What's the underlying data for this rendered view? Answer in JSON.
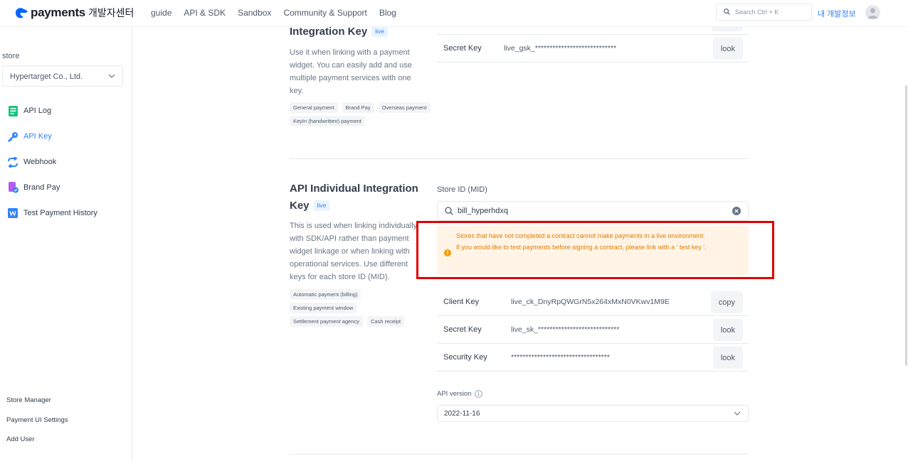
{
  "header": {
    "logo_text": "payments",
    "logo_sub": "개발자센터",
    "nav": [
      "guide",
      "API & SDK",
      "Sandbox",
      "Community & Support",
      "Blog"
    ],
    "search_placeholder": "Search Ctrl + K",
    "my_dev_info": "내 개발정보"
  },
  "sidebar": {
    "store_label": "store",
    "store_value": "Hypertarget Co., Ltd.",
    "items": [
      {
        "label": "API Log",
        "icon": "api-log-icon",
        "color": "#15c47e"
      },
      {
        "label": "API Key",
        "icon": "key-icon",
        "color": "#3182f6"
      },
      {
        "label": "Webhook",
        "icon": "webhook-icon",
        "color": "#3182f6"
      },
      {
        "label": "Brand Pay",
        "icon": "brand-pay-icon",
        "color": "#b45cf0"
      },
      {
        "label": "Test Payment History",
        "icon": "test-history-icon",
        "color": "#3182f6"
      }
    ],
    "bottom_links": [
      "Store Manager",
      "Payment UI Settings",
      "Add User"
    ]
  },
  "widget_section": {
    "title": "Integration Key",
    "badge": "live",
    "description": "Use it when linking with a payment widget. You can easily add and use multiple payment services with one key.",
    "tags": [
      "General payment",
      "Brand Pay",
      "Overseas payment",
      "KeyIn (handwritten) payment"
    ],
    "secret_key_label": "Secret Key",
    "secret_key_value": "live_gsk_****************************",
    "look_label": "look"
  },
  "api_section": {
    "title_line1": "API Individual Integration",
    "title_line2": "Key",
    "badge": "live",
    "description": "This is used when linking individually with SDK/API rather than payment widget linkage or when linking with operational services. Use different keys for each store ID (MID).",
    "tags": [
      "Automatic payment (billing)",
      "Existing payment window",
      "Settlement payment agency",
      "Cash receipt"
    ],
    "mid_label": "Store ID (MID)",
    "mid_value": "bill_hyperhdxq",
    "warning_line1": "Stores that have not completed a contract cannot make payments in a live environment.",
    "warning_line2": "If you would like to test payments before signing a contract, please link with a ' test key '.",
    "keys": [
      {
        "label": "Client Key",
        "value": "live_ck_DnyRpQWGrN5x264xMxN0VKwv1M9E",
        "button": "copy"
      },
      {
        "label": "Secret Key",
        "value": "live_sk_****************************",
        "button": "look"
      },
      {
        "label": "Security Key",
        "value": "**********************************",
        "button": "look"
      }
    ],
    "api_version_label": "API version",
    "api_version_value": "2022-11-16"
  }
}
